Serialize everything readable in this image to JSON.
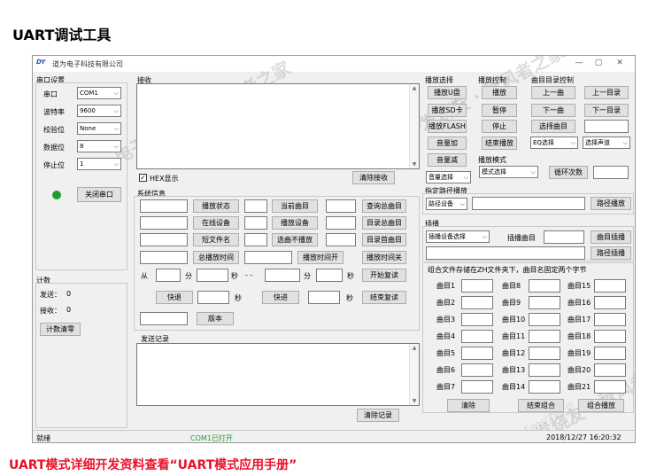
{
  "page_title": "UART调试工具",
  "bottom_note": "UART模式详细开发资料查看“UART模式应用手册”",
  "watermark": {
    "text": "电子发烧友 · 秋风者之家",
    "sub": "ElecFans/刘彦立"
  },
  "window": {
    "logo": "DY",
    "title": "道为电子科技有限公司",
    "min": "—",
    "max": "▢",
    "close": "✕"
  },
  "serial": {
    "title": "串口设置",
    "fields": [
      {
        "label": "串口",
        "value": "COM1"
      },
      {
        "label": "波特率",
        "value": "9600"
      },
      {
        "label": "校验位",
        "value": "None"
      },
      {
        "label": "数据位",
        "value": "8"
      },
      {
        "label": "停止位",
        "value": "1"
      }
    ],
    "close_button": "关闭串口",
    "led_color": "#1e9e2e"
  },
  "count": {
    "title": "计数",
    "send_label": "发送：",
    "send_value": "0",
    "recv_label": "接收：",
    "recv_value": "0",
    "clear_button": "计数清零"
  },
  "receive": {
    "title": "接收",
    "hex_label": "HEX显示",
    "hex_checked": "✓",
    "clear_button": "清除接收"
  },
  "sysinfo": {
    "title": "系统信息",
    "rows": [
      [
        "播放状态",
        "当前曲目",
        "查询总曲目"
      ],
      [
        "在线设备",
        "播放设备",
        "目录总曲目"
      ],
      [
        "短文件名",
        "选曲不播放",
        "目录首曲目"
      ],
      [
        "总播放时间",
        "播放时间开",
        "播放时间关"
      ]
    ],
    "from": "从",
    "fen": "分",
    "miao": "秒",
    "dash": "- -",
    "start_repeat": "开始复读",
    "end_repeat": "结束复读",
    "rewind": "快退",
    "forward": "快进",
    "version": "版本"
  },
  "send": {
    "title": "发送记录",
    "clear_button": "清除记录"
  },
  "play_select": {
    "title": "播放选择",
    "items": [
      "播放U盘",
      "播放SD卡",
      "播放FLASH",
      "音量加",
      "音量减"
    ],
    "volume_select": "音量选择"
  },
  "play_control": {
    "title": "播放控制",
    "items": [
      "播放",
      "暂停",
      "停止",
      "结束播放"
    ],
    "eq_select": "EQ选择"
  },
  "dir_control": {
    "title": "曲目目录控制",
    "items": [
      "上一曲",
      "下一曲",
      "选择曲目",
      "上一目录",
      "下一目录"
    ],
    "channel_select": "选择声道"
  },
  "play_mode": {
    "title": "播放模式",
    "mode_select": "模式选择",
    "loop_button": "循环次数"
  },
  "path_play": {
    "title": "指定路径播放",
    "device_select": "路径设备",
    "button": "路径播放"
  },
  "insert": {
    "title": "插播",
    "device_select": "插播设备选择",
    "track_label": "插播曲目",
    "track_button": "曲目插播",
    "path_button": "路径插播"
  },
  "combo": {
    "title": "组合文件存储在ZH文件夹下，曲目名固定两个字节",
    "tracks": [
      "曲目1",
      "曲目2",
      "曲目3",
      "曲目4",
      "曲目5",
      "曲目6",
      "曲目7",
      "曲目8",
      "曲目9",
      "曲目10",
      "曲目11",
      "曲目12",
      "曲目13",
      "曲目14",
      "曲目15",
      "曲目16",
      "曲目17",
      "曲目18",
      "曲目19",
      "曲目20",
      "曲目21"
    ],
    "clear_button": "清除",
    "end_button": "结束组合",
    "play_button": "组合播放"
  },
  "statusbar": {
    "ready": "就绪",
    "com_status": "COM1已打开",
    "datetime": "2018/12/27  16:20:32"
  }
}
